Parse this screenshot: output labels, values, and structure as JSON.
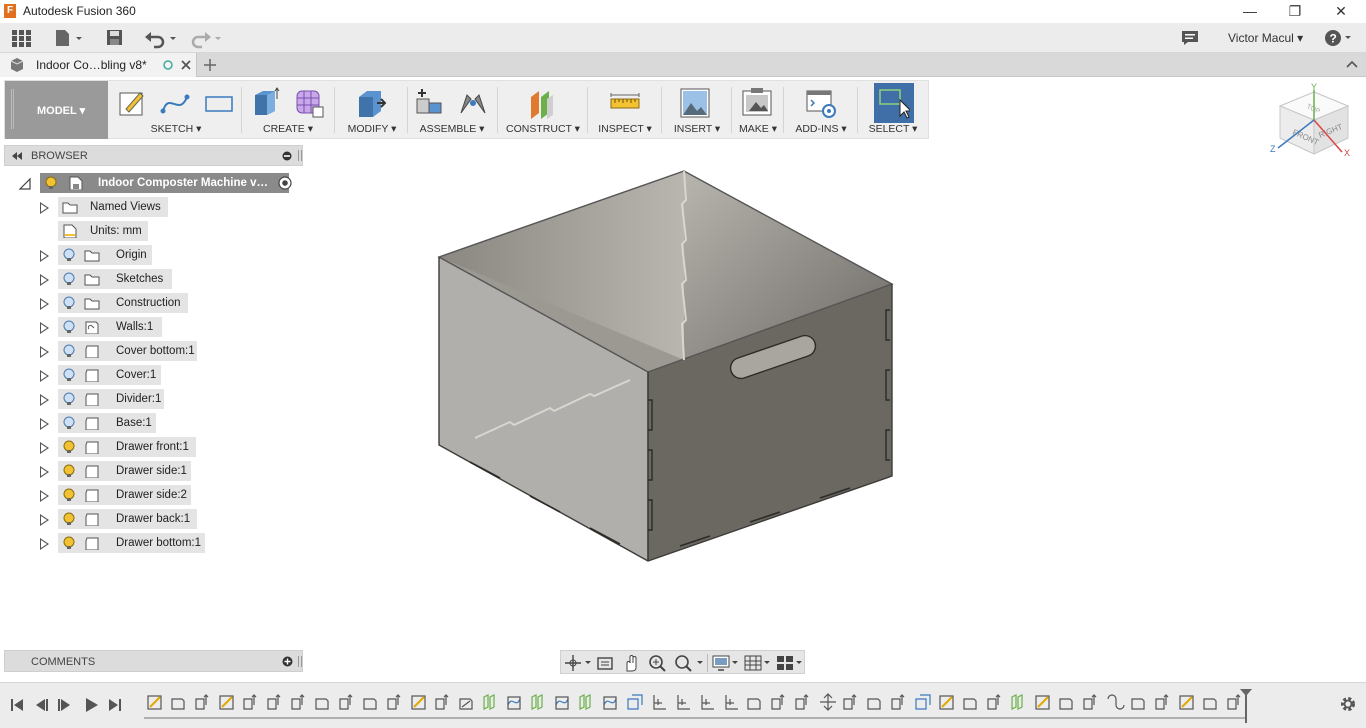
{
  "window": {
    "title": "Autodesk Fusion 360",
    "minimize": "—",
    "maximize": "❐",
    "close": "✕"
  },
  "qat": {
    "user_name": "Victor Macul ▾"
  },
  "document_tab": {
    "title": "Indoor Co…bling v8*"
  },
  "toolbar": {
    "workspace": "MODEL ▾",
    "groups": [
      {
        "label": "SKETCH ▾"
      },
      {
        "label": "CREATE ▾"
      },
      {
        "label": "MODIFY ▾"
      },
      {
        "label": "ASSEMBLE ▾"
      },
      {
        "label": "CONSTRUCT ▾"
      },
      {
        "label": "INSPECT ▾"
      },
      {
        "label": "INSERT ▾"
      },
      {
        "label": "MAKE ▾"
      },
      {
        "label": "ADD-INS ▾"
      },
      {
        "label": "SELECT ▾"
      }
    ]
  },
  "browser": {
    "title": "BROWSER",
    "root": "Indoor Composter Machine v…",
    "items": [
      {
        "label": "Named Views",
        "light": false,
        "bulb": "none"
      },
      {
        "label": "Units: mm",
        "light": false,
        "bulb": "none"
      },
      {
        "label": "Origin",
        "bulb": "blue"
      },
      {
        "label": "Sketches",
        "bulb": "blue"
      },
      {
        "label": "Construction",
        "bulb": "blue"
      },
      {
        "label": "Walls:1",
        "bulb": "blue"
      },
      {
        "label": "Cover bottom:1",
        "bulb": "blue"
      },
      {
        "label": "Cover:1",
        "bulb": "blue"
      },
      {
        "label": "Divider:1",
        "bulb": "blue"
      },
      {
        "label": "Base:1",
        "bulb": "blue"
      },
      {
        "label": "Drawer front:1",
        "bulb": "yellow"
      },
      {
        "label": "Drawer side:1",
        "bulb": "yellow"
      },
      {
        "label": "Drawer side:2",
        "bulb": "yellow"
      },
      {
        "label": "Drawer back:1",
        "bulb": "yellow"
      },
      {
        "label": "Drawer bottom:1",
        "bulb": "yellow"
      }
    ]
  },
  "comments": {
    "title": "COMMENTS"
  },
  "viewcube": {
    "front": "FRONT",
    "right": "RIGHT",
    "top": "TOP",
    "x": "X",
    "y": "Y",
    "z": "Z"
  },
  "colors": {
    "accent": "#3a7abd",
    "select_active": "#3f6fa6",
    "workspace_bg": "#9a9a9a"
  }
}
